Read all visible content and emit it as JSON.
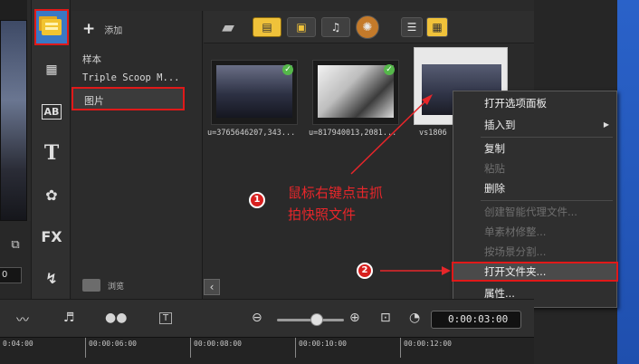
{
  "library": {
    "add_label": "添加",
    "items": [
      "样本",
      "Triple Scoop M...",
      "图片"
    ],
    "browse_label": "浏览"
  },
  "media": {
    "thumbnails": [
      {
        "label": "u=3765646207,343..."
      },
      {
        "label": "u=817940013,2081..."
      },
      {
        "label": "vs1806"
      }
    ]
  },
  "annotations": {
    "step1_badge": "1",
    "step1_line1": "鼠标右键点击抓",
    "step1_line2": "拍快照文件",
    "step2_badge": "2"
  },
  "context_menu": {
    "items": [
      {
        "label": "打开选项面板",
        "enabled": true
      },
      {
        "label": "插入到",
        "enabled": true,
        "submenu": true
      },
      {
        "label": "复制",
        "enabled": true
      },
      {
        "label": "粘贴",
        "enabled": false
      },
      {
        "label": "删除",
        "enabled": true
      },
      {
        "label": "创建智能代理文件...",
        "enabled": false
      },
      {
        "label": "单素材修整...",
        "enabled": false
      },
      {
        "label": "按场景分割...",
        "enabled": false
      },
      {
        "label": "打开文件夹...",
        "enabled": true,
        "highlighted": true
      },
      {
        "label": "属性...",
        "enabled": true
      }
    ]
  },
  "timeline": {
    "timecode": "0:00:03:00",
    "ticks": [
      "0:04:00",
      "00:00:06:00",
      "00:00:08:00",
      "00:00:10:00",
      "00:00:12:00"
    ]
  },
  "left": {
    "field_value": "0"
  },
  "colors": {
    "annotation_red": "#e8262a",
    "selection_border": "#e01919",
    "desktop_blue": "#2a62c9"
  }
}
